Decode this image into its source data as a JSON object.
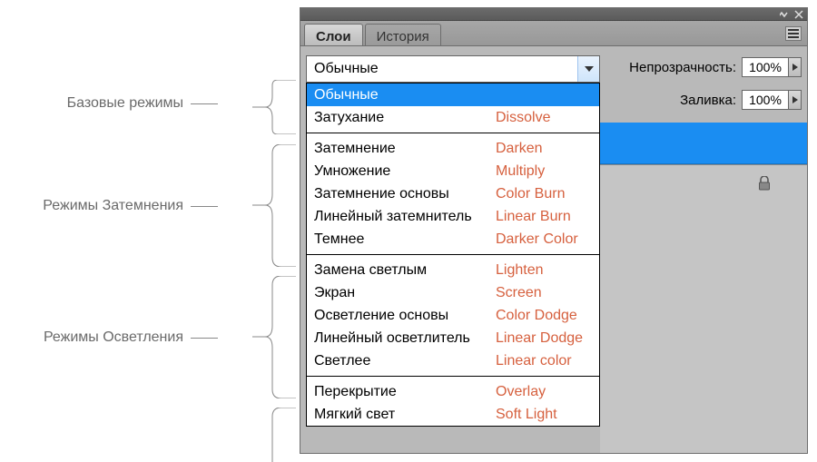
{
  "annotations": {
    "basic": "Базовые режимы",
    "darken": "Режимы Затемнения",
    "lighten": "Режимы Осветления"
  },
  "panel": {
    "tabs": {
      "layers": "Слои",
      "history": "История"
    },
    "opacity": {
      "label": "Непрозрачность:",
      "value": "100%"
    },
    "fill": {
      "label": "Заливка:",
      "value": "100%"
    },
    "blend_selected": "Обычные"
  },
  "blend_groups": [
    {
      "key": "basic",
      "items": [
        {
          "ru": "Обычные",
          "en": "",
          "selected": true
        },
        {
          "ru": "Затухание",
          "en": "Dissolve"
        }
      ]
    },
    {
      "key": "darken",
      "items": [
        {
          "ru": "Затемнение",
          "en": "Darken"
        },
        {
          "ru": "Умножение",
          "en": "Multiply"
        },
        {
          "ru": "Затемнение основы",
          "en": "Color Burn"
        },
        {
          "ru": "Линейный затемнитель",
          "en": "Linear Burn"
        },
        {
          "ru": "Темнее",
          "en": "Darker Color"
        }
      ]
    },
    {
      "key": "lighten",
      "items": [
        {
          "ru": "Замена светлым",
          "en": "Lighten"
        },
        {
          "ru": "Экран",
          "en": "Screen"
        },
        {
          "ru": "Осветление основы",
          "en": "Color Dodge"
        },
        {
          "ru": "Линейный осветлитель",
          "en": "Linear Dodge"
        },
        {
          "ru": "Светлее",
          "en": "Linear color"
        }
      ]
    },
    {
      "key": "contrast",
      "items": [
        {
          "ru": "Перекрытие",
          "en": "Overlay"
        },
        {
          "ru": "Мягкий свет",
          "en": "Soft Light"
        }
      ]
    }
  ]
}
